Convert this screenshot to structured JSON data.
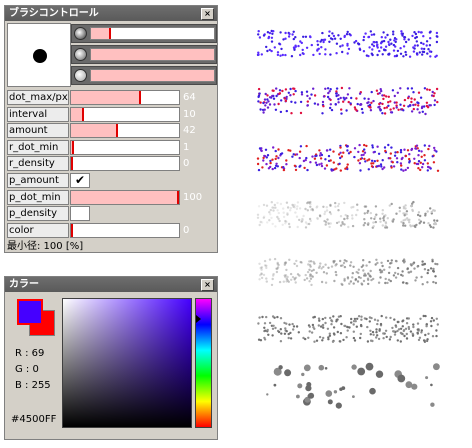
{
  "brush_panel": {
    "title": "ブラシコントロール",
    "close_label": "×",
    "chips": [
      {
        "icon": "dark-dot-icon",
        "color": "#303030",
        "fill": 0.15
      },
      {
        "icon": "medium-dot-icon",
        "color": "#606060",
        "fill": 1.0
      },
      {
        "icon": "light-dot-icon",
        "color": "#a0a0a0",
        "fill": 1.0
      }
    ],
    "params": [
      {
        "label": "dot_max/px",
        "type": "slider",
        "fill": 0.64,
        "value": "64"
      },
      {
        "label": "interval",
        "type": "slider",
        "fill": 0.1,
        "value": "10"
      },
      {
        "label": "amount",
        "type": "slider",
        "fill": 0.42,
        "value": "42"
      },
      {
        "label": "r_dot_min",
        "type": "slider",
        "fill": 0.01,
        "value": "1"
      },
      {
        "label": "r_density",
        "type": "slider",
        "fill": 0.0,
        "value": "0"
      },
      {
        "label": "p_amount",
        "type": "check",
        "checked": true,
        "check_glyph": "✔"
      },
      {
        "label": "p_dot_min",
        "type": "slider",
        "fill": 1.0,
        "value": "100"
      },
      {
        "label": "p_density",
        "type": "check",
        "checked": false,
        "check_glyph": ""
      },
      {
        "label": "color",
        "type": "slider",
        "fill": 0.0,
        "value": "0"
      }
    ],
    "status": "最小径: 100 [%]"
  },
  "color_panel": {
    "title": "カラー",
    "close_label": "×",
    "foreground": "#4500FF",
    "background": "#FF0000",
    "r_label": "R : 69",
    "g_label": "G : 0",
    "b_label": "B : 255",
    "hex": "#4500FF",
    "hue_position": 0.16
  },
  "samples": [
    {
      "style": "uniform",
      "colors": [
        "#3a1ee0",
        "#5a2cff"
      ]
    },
    {
      "style": "uniform",
      "colors": [
        "#6a1fd0",
        "#e01040",
        "#3a1ee0"
      ]
    },
    {
      "style": "uniform",
      "colors": [
        "#e02020",
        "#3a20e0",
        "#7a1fd0"
      ]
    },
    {
      "style": "fade",
      "colors": [
        "#c8c8c8",
        "#8a8a8a"
      ]
    },
    {
      "style": "fade",
      "colors": [
        "#707070",
        "#909090"
      ]
    },
    {
      "style": "uniform",
      "colors": [
        "#707070",
        "#909090"
      ]
    },
    {
      "style": "big",
      "colors": [
        "#6a6a6a",
        "#8a8a8a"
      ]
    }
  ]
}
